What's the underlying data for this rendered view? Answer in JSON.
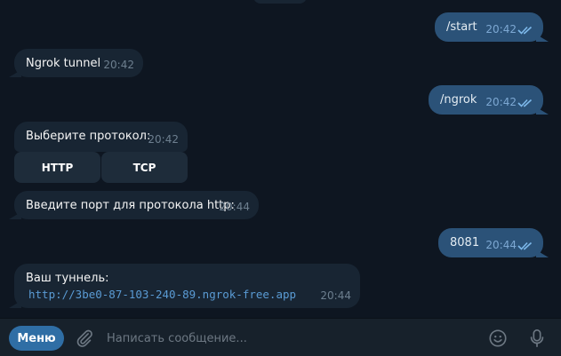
{
  "messages": [
    {
      "text": "/start",
      "time": "20:42"
    },
    {
      "text": "Ngrok tunnel",
      "time": "20:42"
    },
    {
      "text": "/ngrok",
      "time": "20:42"
    },
    {
      "text": "Выберите протокол:",
      "time": "20:42",
      "buttons": [
        "HTTP",
        "TCP"
      ]
    },
    {
      "text": "Введите порт для протокола http:",
      "time": "20:44"
    },
    {
      "text": "8081",
      "time": "20:44"
    },
    {
      "text": "Ваш туннель:",
      "link": "http://3be0-87-103-240-89.ngrok-free.app",
      "time": "20:44"
    }
  ],
  "composer": {
    "menu_label": "Меню",
    "placeholder": "Написать сообщение...",
    "attach_icon": "paperclip-icon",
    "emoji_icon": "emoji-icon",
    "mic_icon": "microphone-icon"
  },
  "colors": {
    "background": "#0e1621",
    "incoming_bubble": "#182533",
    "outgoing_bubble": "#2b5278",
    "link": "#5a9bd4",
    "menu_button": "#2f6ea5"
  }
}
